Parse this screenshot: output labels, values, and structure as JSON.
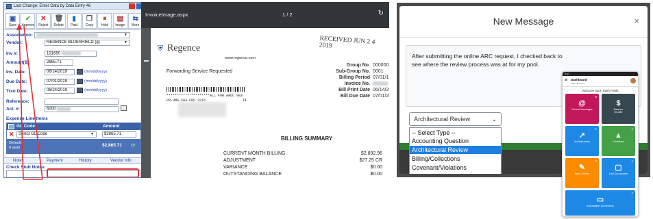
{
  "entry_form": {
    "title": "Last Change: Enter Data by Data Entry 46",
    "toolbar": [
      {
        "label": "Save",
        "icon": "save-icon",
        "glyph": "▣",
        "color": "#2e5aa8"
      },
      {
        "label": "Approve",
        "icon": "approve-icon",
        "glyph": "✓",
        "color": "#2e8b3a"
      },
      {
        "label": "Reject",
        "icon": "reject-icon",
        "glyph": "✕",
        "color": "#c62828"
      },
      {
        "label": "Delete",
        "icon": "delete-icon",
        "glyph": "🗑",
        "color": "#555555"
      },
      {
        "label": "Paid",
        "icon": "paid-icon",
        "glyph": "▮",
        "color": "#1e6fc8"
      },
      {
        "label": "Copy",
        "icon": "copy-icon",
        "glyph": "❐",
        "color": "#555555"
      },
      {
        "label": "Hold",
        "icon": "hold-icon",
        "glyph": "⏸",
        "color": "#8a4a1a"
      },
      {
        "label": "Image",
        "icon": "image-icon",
        "glyph": "▤",
        "color": "#b03030"
      },
      {
        "label": "More",
        "icon": "more-icon",
        "glyph": "⇆",
        "color": "#2e5aa8"
      }
    ],
    "fields": {
      "association_label": "Association:",
      "vendor_label": "Vendor:",
      "vendor_value": "REGENCE BLUESHIELD (g)",
      "inv_label": "Inv #:",
      "inv_value": "191650",
      "amount_label": "Amount($):",
      "amount_value": "2865.71",
      "inv_date_label": "Inv. Date:",
      "inv_date_value": "06/14/2019",
      "due_date_label": "Due Date:",
      "due_date_value": "07/01/2019",
      "trxn_date_label": "Trxn Date:",
      "trxn_date_value": "06/24/2019",
      "date_hint": "(mm/dd/yyyy)",
      "reference_label": "Reference:",
      "act_label": "Act. #:",
      "act_value": "6000"
    },
    "expense": {
      "title": "Expense Line Items",
      "col_gl": "GL Code",
      "col_amount": "Amount",
      "gl_select": "Select GL Code",
      "row_amount": "$2865.71",
      "default_label": "Default:",
      "default_sub": "0 avail",
      "total": "$2,865.71"
    },
    "tabs": [
      "Notes",
      "Payment",
      "History",
      "Vendor Info"
    ],
    "stub_label": "Check Stub Notes:"
  },
  "pdf_viewer": {
    "filename": "InvoiceImage.aspx",
    "page_indicator": "1 / 2",
    "doc": {
      "stamp": "RECEIVED JUN 2 4 2019",
      "brand": "Regence",
      "website": "www.regence.com",
      "forwarding": "Forwarding Service Requested",
      "addr_line": "*********************ALL FOR AADC 983",
      "addr_sub": "PR-UMA-S04-CRU 3216",
      "addr_num": "14",
      "group_label": "Group No.",
      "group_value": "00000045",
      "subgroup_label": "Sub-Group No.",
      "subgroup_value": "0001",
      "billing_label": "Billing Period",
      "billing_value": "07/01/19-07/31/1",
      "invoice_label": "Invoice No.",
      "print_label": "Bill Print Date",
      "print_value": "06/14/2019",
      "due_label": "Bill Due Date",
      "due_value": "07/01/2019",
      "summary_title": "BILLING SUMMARY",
      "lines": [
        {
          "label": "CURRENT MONTH BILLING",
          "value": "$2,892.96"
        },
        {
          "label": "ADJUSTMENT",
          "value": "$27.25 CR"
        },
        {
          "label": "VARIANCE",
          "value": "$0.00"
        },
        {
          "label": "OUTSTANDING BALANCE",
          "value": "$0.00"
        }
      ]
    }
  },
  "message_modal": {
    "title": "New Message",
    "close_glyph": "×",
    "body": "After submitting the online ARC request, I checked back to see where the review process was at for my pool.",
    "select_value": "Architectural Review",
    "options": [
      "-- Select Type --",
      "Accounting Question",
      "Architectural Review",
      "Billing/Collections",
      "Covenant/Violations"
    ],
    "selected_index": 2
  },
  "phone": {
    "status": "8:47",
    "header_title": "Dashboard",
    "header_sub": "ARC Library III",
    "welcome": "Welcome back, Keith Fields",
    "tiles": [
      {
        "label": "Recent Messages",
        "count": "0",
        "glyph": "@",
        "color": "#c2185b"
      },
      {
        "label": "Balance",
        "value": "$1,280",
        "glyph": "$",
        "color": "#37474f"
      },
      {
        "label": "Architecturals",
        "count": "1",
        "glyph": "↗",
        "color": "#1e88e5"
      },
      {
        "label": "Violations",
        "count": "1",
        "glyph": "▲",
        "color": "#43a047"
      },
      {
        "label": "Work Orders",
        "count": "2",
        "glyph": "✎",
        "color": "#fb8c00"
      },
      {
        "label": "Unit Documents",
        "count": "1",
        "glyph": "▢",
        "color": "#1e88e5"
      },
      {
        "label": "Association Documents",
        "count": "7",
        "glyph": "▭",
        "color": "#1e88e5"
      }
    ]
  }
}
